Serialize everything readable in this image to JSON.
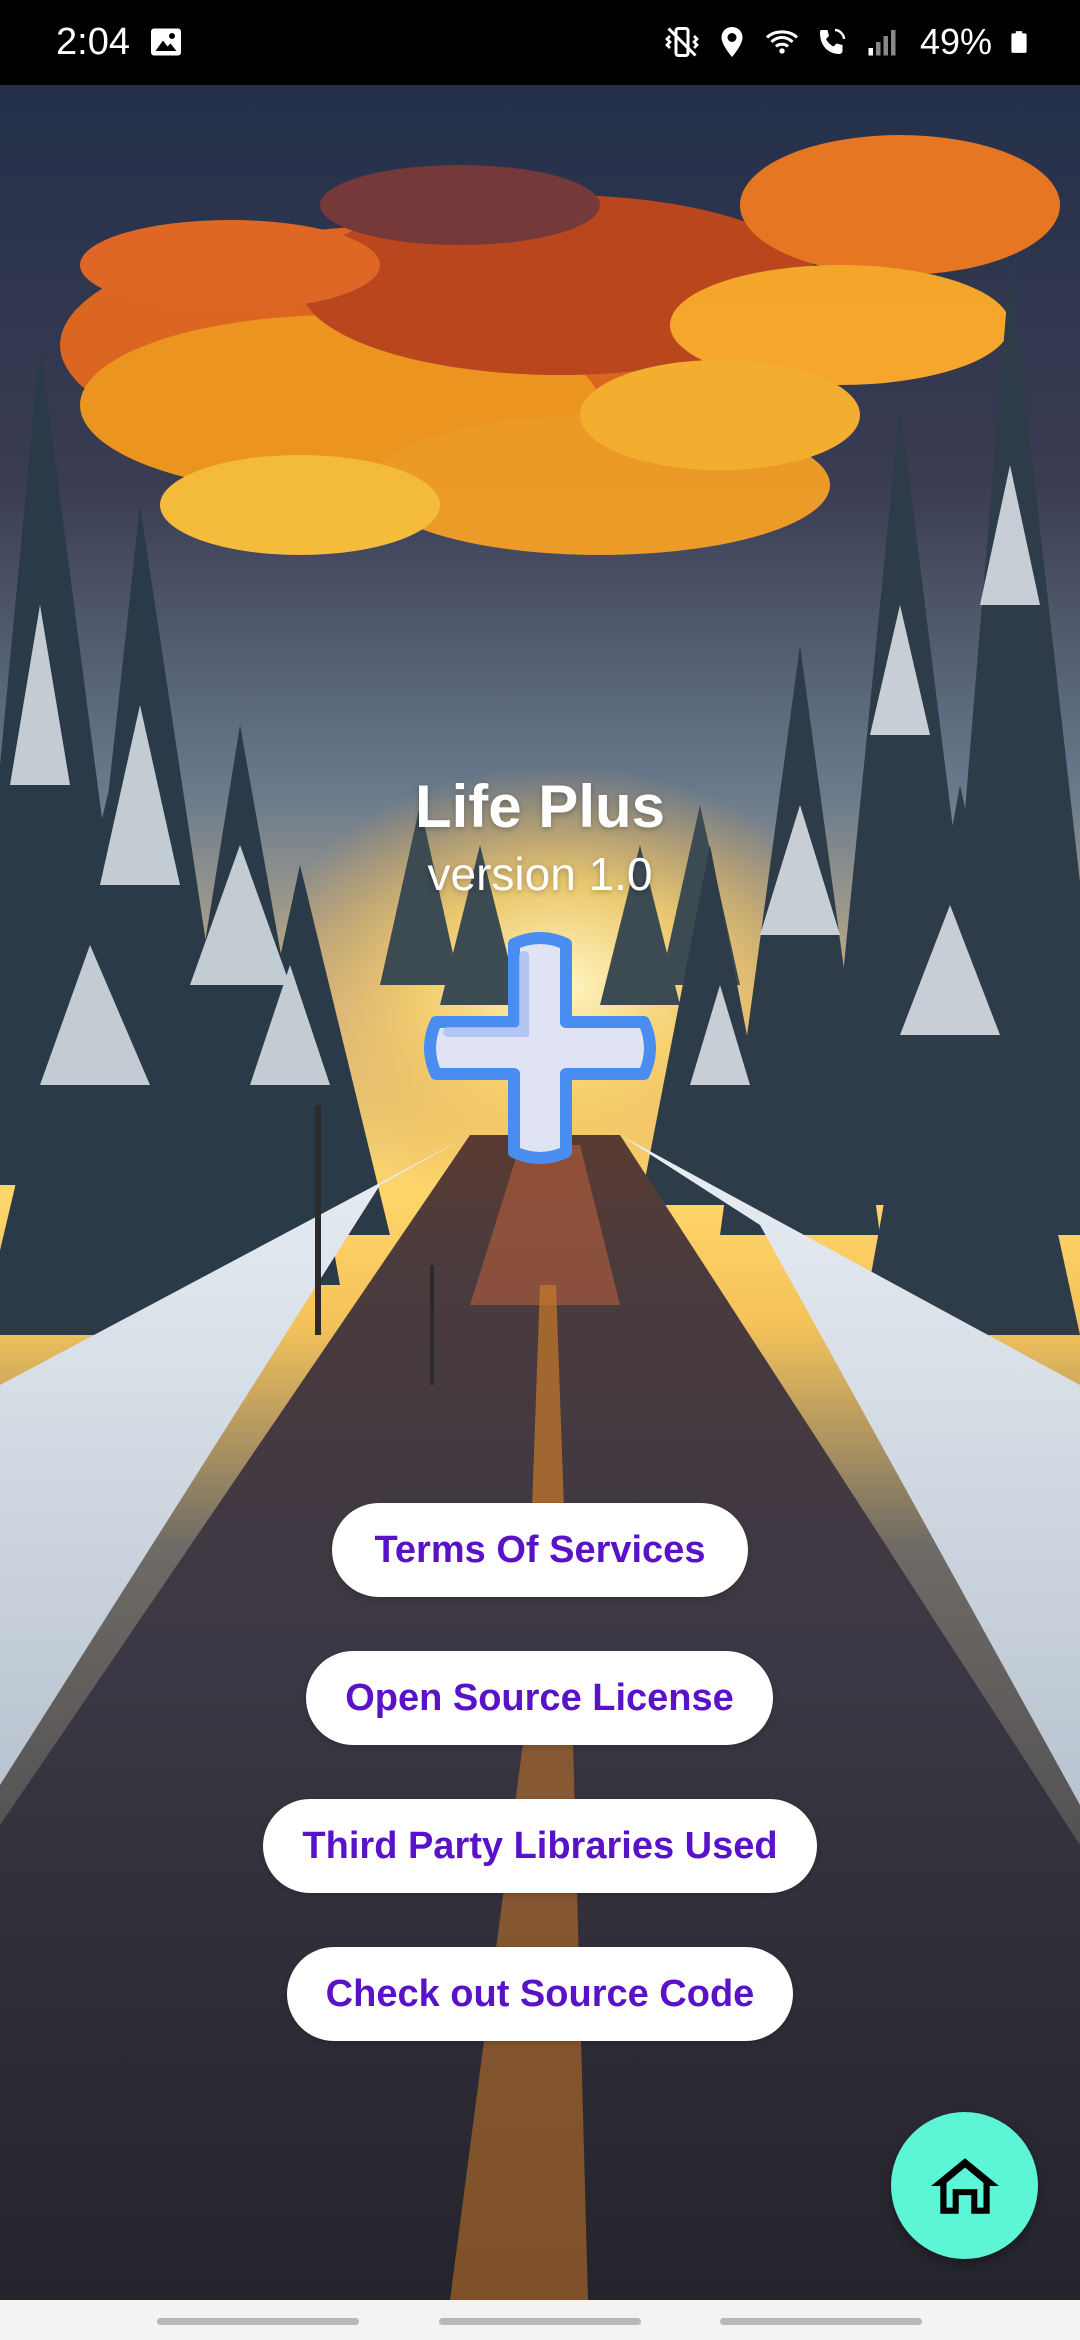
{
  "status_bar": {
    "time": "2:04",
    "battery_percent": "49%",
    "icons": [
      "gallery-icon",
      "vibrate-icon",
      "location-icon",
      "wifi-icon",
      "wifi-calling-icon",
      "signal-icon",
      "battery-icon"
    ]
  },
  "app": {
    "title": "Life Plus",
    "version": "version 1.0",
    "logo_icon": "plus-icon"
  },
  "buttons": {
    "terms": "Terms Of Services",
    "license": "Open Source License",
    "third_party": "Third Party Libraries Used",
    "source_code": "Check out Source Code"
  },
  "fab": {
    "icon": "home-icon"
  },
  "colors": {
    "button_text": "#5a12c9",
    "button_bg": "#ffffff",
    "fab_bg": "#5cf5d5",
    "logo_fill": "#dfe3f3",
    "logo_stroke": "#4a8df0"
  }
}
